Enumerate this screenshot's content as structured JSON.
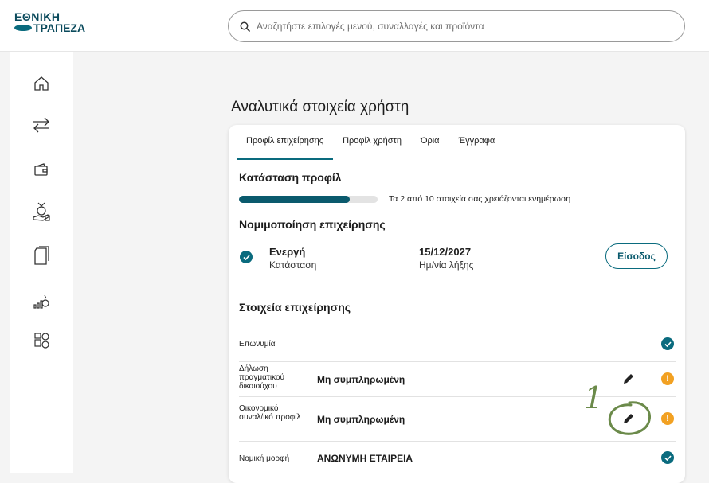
{
  "header": {
    "logo_line1": "ΕΘΝΙΚΗ",
    "logo_line2": "ΤΡΑΠΕΖΑ",
    "search_placeholder": "Αναζητήστε επιλογές μενού, συναλλαγές και προϊόντα"
  },
  "sidebar": {
    "items": [
      "home-icon",
      "transfer-icon",
      "wallet-icon",
      "loan-icon",
      "documents-icon",
      "investments-icon",
      "support-icon"
    ]
  },
  "page": {
    "title": "Αναλυτικά στοιχεία χρήστη"
  },
  "tabs": [
    {
      "label": "Προφίλ επιχείρησης",
      "active": true
    },
    {
      "label": "Προφίλ χρήστη",
      "active": false
    },
    {
      "label": "Όρια",
      "active": false
    },
    {
      "label": "Έγγραφα",
      "active": false
    }
  ],
  "profile_status": {
    "heading": "Κατάσταση προφίλ",
    "progress_fraction": 0.8,
    "progress_text": "Τα 2 από 10 στοιχεία σας χρειάζονται ενημέρωση"
  },
  "legitimation": {
    "heading": "Νομιμοποίηση επιχείρησης",
    "status_value": "Ενεργή",
    "status_label": "Κατάσταση",
    "expiry_value": "15/12/2027",
    "expiry_label": "Ημ/νία λήξης",
    "button_label": "Είσοδος"
  },
  "business_info": {
    "heading": "Στοιχεία επιχείρησης",
    "rows": [
      {
        "label": "Επωνυμία",
        "value": "",
        "editable": false,
        "status": "ok"
      },
      {
        "label": "Δήλωση πραγματικού δικαιούχου",
        "value": "Μη συμπληρωμένη",
        "editable": true,
        "status": "warning"
      },
      {
        "label": "Οικονομικό συναλ/ικό προφίλ",
        "value": "Μη συμπληρωμένη",
        "editable": true,
        "status": "warning"
      },
      {
        "label": "Νομική μορφή",
        "value": "ΑΝΩΝΥΜΗ ΕΤΑΙΡΕΙΑ",
        "editable": false,
        "status": "ok"
      }
    ]
  },
  "annotation": {
    "number": "1",
    "color": "#6b8a4a"
  },
  "colors": {
    "brand": "#0a6b7e",
    "warning": "#f2a122"
  }
}
